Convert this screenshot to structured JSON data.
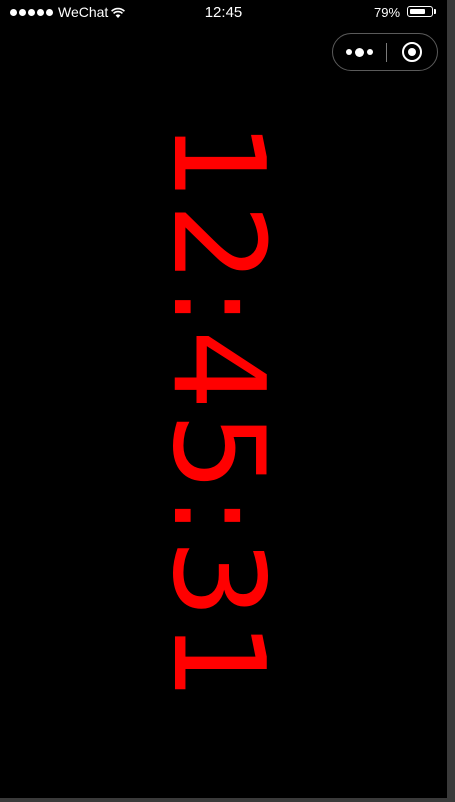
{
  "status_bar": {
    "carrier": "WeChat",
    "time": "12:45",
    "battery_percent": "79%",
    "battery_level": 0.79,
    "signal_dots": 5,
    "wifi_icon": "wifi-icon"
  },
  "capsule": {
    "more_icon": "more-dots-icon",
    "close_icon": "target-circle-icon"
  },
  "clock": {
    "display": "12:45:31",
    "color": "#ff0000",
    "background": "#000000"
  }
}
